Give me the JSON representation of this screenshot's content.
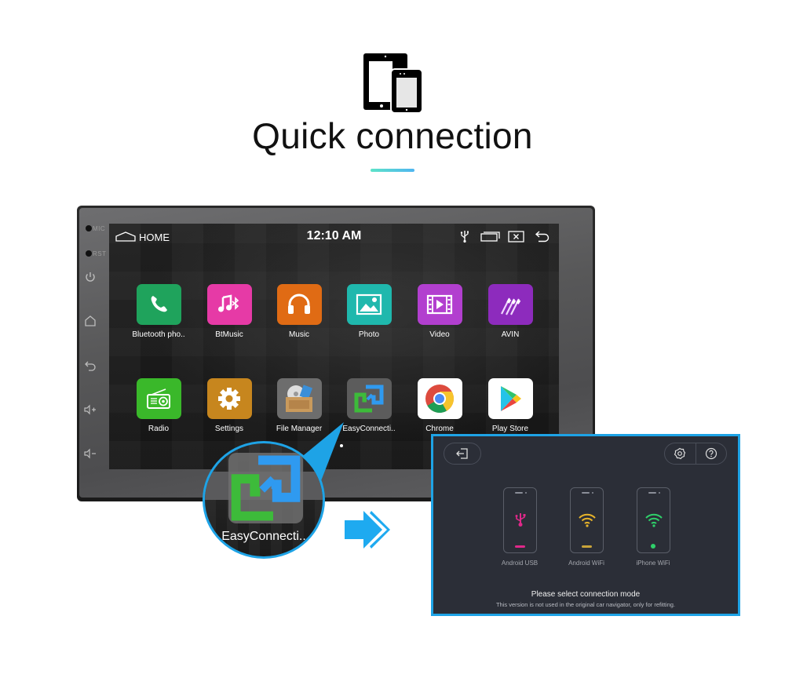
{
  "hero": {
    "icon": "tablet-phone-icon",
    "title": "Quick connection",
    "accent_gradient": [
      "#5de3c8",
      "#4fb5f0"
    ]
  },
  "head_unit": {
    "bezel_labels": {
      "mic": "MIC",
      "rst": "RST"
    },
    "side_buttons": [
      {
        "icon": "power-icon",
        "name": "power"
      },
      {
        "icon": "home-icon",
        "name": "home"
      },
      {
        "icon": "back-icon",
        "name": "back"
      },
      {
        "icon": "volume-up-icon",
        "name": "volume-up"
      },
      {
        "icon": "volume-down-icon",
        "name": "volume-down"
      }
    ],
    "statusbar": {
      "home_label": "HOME",
      "clock": "12:10 AM",
      "icons": [
        "usb-icon",
        "recent-apps-icon",
        "close-window-icon",
        "back-icon"
      ]
    },
    "apps": [
      {
        "label": "Bluetooth pho..",
        "icon": "phone-icon",
        "color": "#1fa35c"
      },
      {
        "label": "BtMusic",
        "icon": "bt-music-icon",
        "color": "#e63aa6"
      },
      {
        "label": "Music",
        "icon": "headphones-icon",
        "color": "#e06b14"
      },
      {
        "label": "Photo",
        "icon": "photo-icon",
        "color": "#1fb8ad"
      },
      {
        "label": "Video",
        "icon": "video-icon",
        "color": "#b23fcf"
      },
      {
        "label": "AVIN",
        "icon": "av-cables-icon",
        "color": "#8d2bbd"
      },
      {
        "label": "Radio",
        "icon": "radio-icon",
        "color": "#3ab82a"
      },
      {
        "label": "Settings",
        "icon": "gear-icon",
        "color": "#c7861e"
      },
      {
        "label": "File Manager",
        "icon": "file-manager-icon",
        "color": "#6d6d6d"
      },
      {
        "label": "EasyConnecti..",
        "icon": "easyconnection-icon",
        "color": "#5c5c5c"
      },
      {
        "label": "Chrome",
        "icon": "chrome-icon",
        "color": "#ffffff"
      },
      {
        "label": "Play Store",
        "icon": "play-store-icon",
        "color": "#ffffff"
      }
    ],
    "page_indicator": {
      "current": 1
    }
  },
  "zoom_callout": {
    "label": "EasyConnecti..",
    "border_color": "#1ea3e6"
  },
  "easyconnection_panel": {
    "back_icon": "exit-icon",
    "tools": [
      {
        "icon": "gear-icon",
        "name": "settings"
      },
      {
        "icon": "help-icon",
        "name": "help"
      }
    ],
    "modes": [
      {
        "label": "Android USB",
        "icon": "usb-icon",
        "color": "#e0288a"
      },
      {
        "label": "Android WiFi",
        "icon": "wifi-icon",
        "color": "#e8b42a"
      },
      {
        "label": "iPhone WiFi",
        "icon": "wifi-icon",
        "color": "#2fd06a"
      }
    ],
    "message": "Please select connection mode",
    "sub_message": "This version is not used in the original car navigator, only for refitting.",
    "border_color": "#1ea3e6",
    "background": "#2b2e37"
  }
}
